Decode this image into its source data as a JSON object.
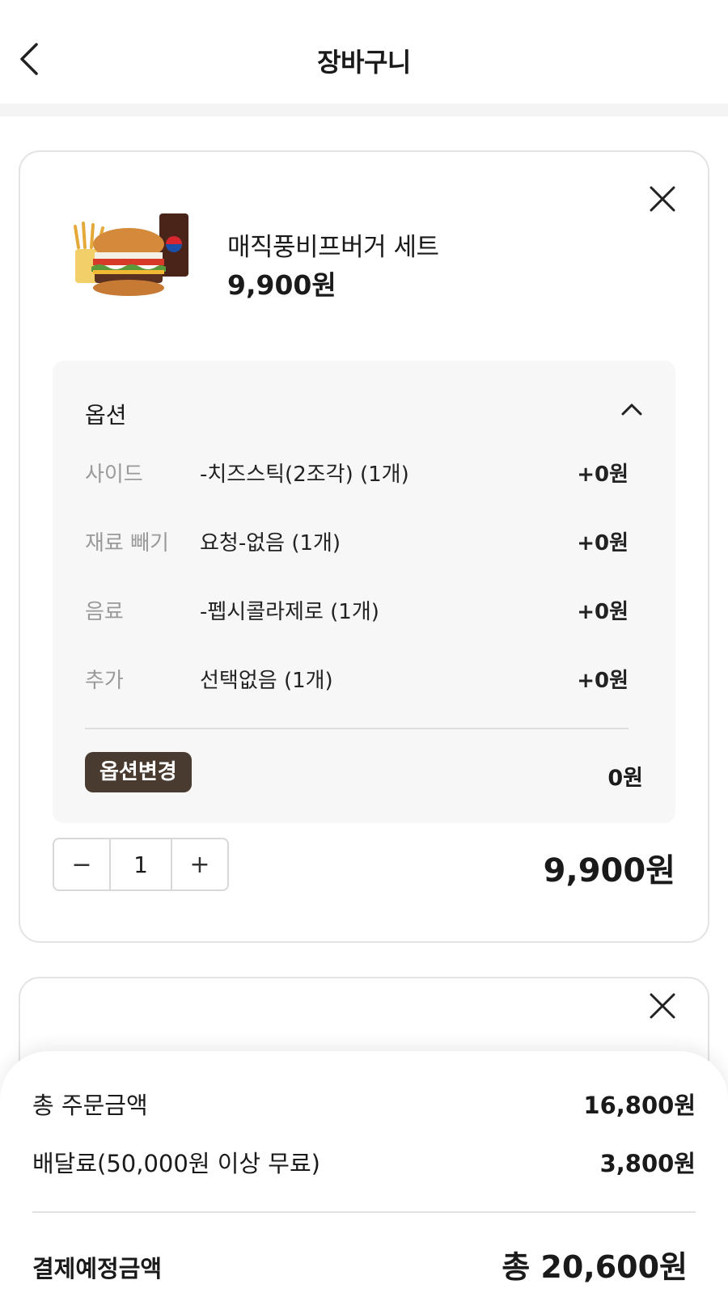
{
  "header": {
    "title": "장바구니"
  },
  "cart": {
    "items": [
      {
        "name": "매직풍비프버거 세트",
        "price": "9,900원",
        "options_title": "옵션",
        "options": [
          {
            "label": "사이드",
            "value": "-치즈스틱(2조각) (1개)",
            "price": "+0원"
          },
          {
            "label": "재료 빼기",
            "value": "요청-없음 (1개)",
            "price": "+0원"
          },
          {
            "label": "음료",
            "value": "-펩시콜라제로 (1개)",
            "price": "+0원"
          },
          {
            "label": "추가",
            "value": "선택없음 (1개)",
            "price": "+0원"
          }
        ],
        "option_change_label": "옵션변경",
        "options_total": "0원",
        "quantity": "1",
        "minus": "−",
        "plus": "+",
        "total": "9,900원"
      }
    ]
  },
  "summary": {
    "order_amount_label": "총 주문금액",
    "order_amount": "16,800원",
    "delivery_label": "배달료(50,000원 이상 무료)",
    "delivery_fee": "3,800원",
    "pay_label": "결제예정금액",
    "pay_total": "총 20,600원"
  }
}
